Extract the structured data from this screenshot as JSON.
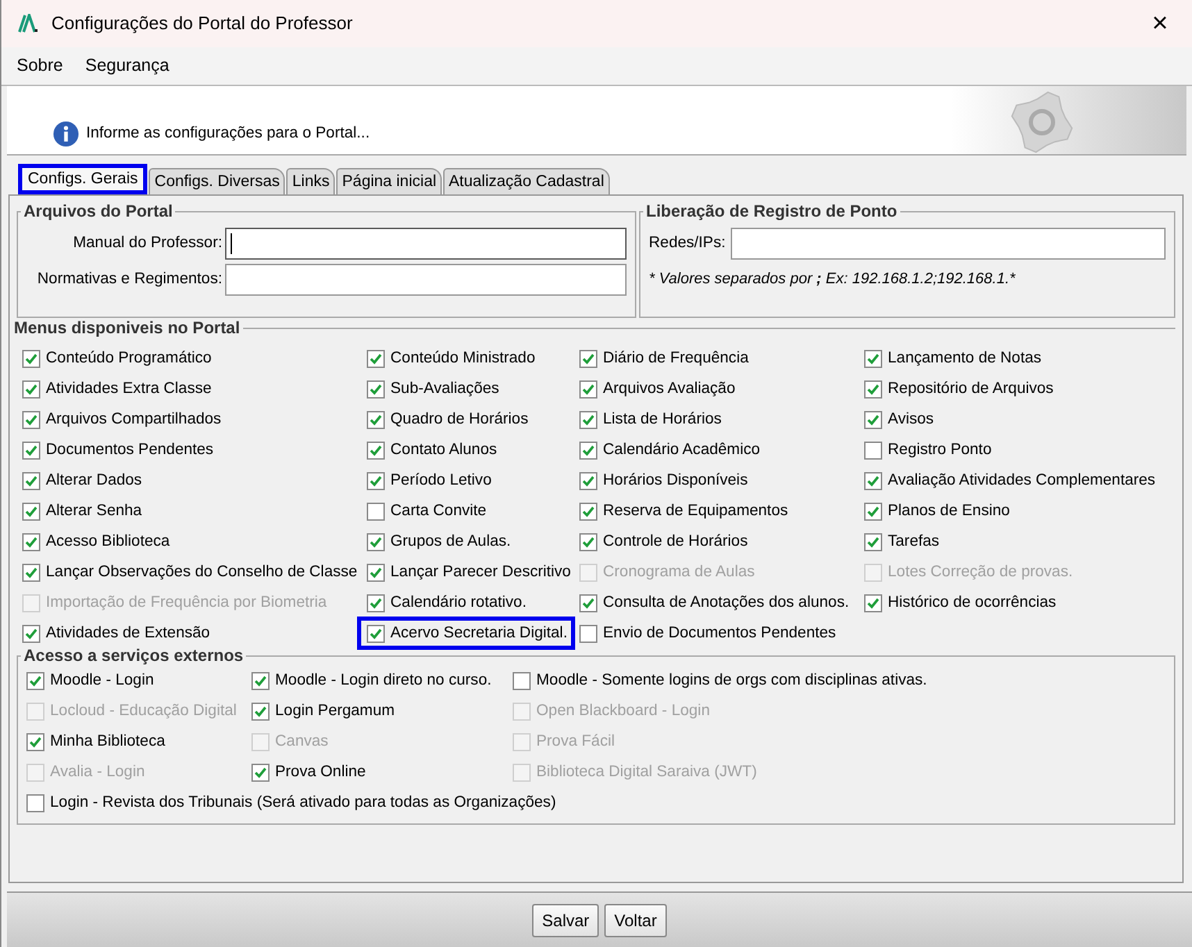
{
  "window": {
    "title": "Configurações do Portal do Professor",
    "close": "×"
  },
  "menu_bar": [
    "Sobre",
    "Segurança"
  ],
  "header": {
    "message": "Informe as configurações para o Portal..."
  },
  "tabs": [
    {
      "label": "Configs. Gerais",
      "selected": true,
      "highlighted": true
    },
    {
      "label": "Configs. Diversas",
      "selected": false,
      "highlighted": false
    },
    {
      "label": "Links",
      "selected": false,
      "highlighted": false
    },
    {
      "label": "Página inicial",
      "selected": false,
      "highlighted": false
    },
    {
      "label": "Atualização Cadastral",
      "selected": false,
      "highlighted": false
    }
  ],
  "arquivos": {
    "title": "Arquivos do Portal",
    "fields": [
      {
        "label": "Manual do Professor:",
        "focused": true
      },
      {
        "label": "Normativas e Regimentos:",
        "focused": false
      }
    ]
  },
  "ponto": {
    "title": "Liberação de Registro de Ponto",
    "field_label": "Redes/IPs:",
    "hint": "* Valores separados por **;** Ex: 192.168.1.2;192.168.1.*"
  },
  "menus": {
    "title": "Menus disponiveis no Portal",
    "items": [
      {
        "label": "Conteúdo Programático",
        "checked": true,
        "disabled": false,
        "highlighted": false
      },
      {
        "label": "Conteúdo Ministrado",
        "checked": true,
        "disabled": false,
        "highlighted": false
      },
      {
        "label": "Diário de Frequência",
        "checked": true,
        "disabled": false,
        "highlighted": false
      },
      {
        "label": "Lançamento de Notas",
        "checked": true,
        "disabled": false,
        "highlighted": false
      },
      {
        "label": "Atividades Extra Classe",
        "checked": true,
        "disabled": false,
        "highlighted": false
      },
      {
        "label": "Sub-Avaliações",
        "checked": true,
        "disabled": false,
        "highlighted": false
      },
      {
        "label": "Arquivos Avaliação",
        "checked": true,
        "disabled": false,
        "highlighted": false
      },
      {
        "label": "Repositório de Arquivos",
        "checked": true,
        "disabled": false,
        "highlighted": false
      },
      {
        "label": "Arquivos Compartilhados",
        "checked": true,
        "disabled": false,
        "highlighted": false
      },
      {
        "label": "Quadro de Horários",
        "checked": true,
        "disabled": false,
        "highlighted": false
      },
      {
        "label": "Lista de Horários",
        "checked": true,
        "disabled": false,
        "highlighted": false
      },
      {
        "label": "Avisos",
        "checked": true,
        "disabled": false,
        "highlighted": false
      },
      {
        "label": "Documentos Pendentes",
        "checked": true,
        "disabled": false,
        "highlighted": false
      },
      {
        "label": "Contato Alunos",
        "checked": true,
        "disabled": false,
        "highlighted": false
      },
      {
        "label": "Calendário Acadêmico",
        "checked": true,
        "disabled": false,
        "highlighted": false
      },
      {
        "label": "Registro Ponto",
        "checked": false,
        "disabled": false,
        "highlighted": false
      },
      {
        "label": "Alterar Dados",
        "checked": true,
        "disabled": false,
        "highlighted": false
      },
      {
        "label": "Período Letivo",
        "checked": true,
        "disabled": false,
        "highlighted": false
      },
      {
        "label": "Horários Disponíveis",
        "checked": true,
        "disabled": false,
        "highlighted": false
      },
      {
        "label": "Avaliação Atividades Complementares",
        "checked": true,
        "disabled": false,
        "highlighted": false
      },
      {
        "label": "Alterar Senha",
        "checked": true,
        "disabled": false,
        "highlighted": false
      },
      {
        "label": "Carta Convite",
        "checked": false,
        "disabled": false,
        "highlighted": false
      },
      {
        "label": "Reserva de Equipamentos",
        "checked": true,
        "disabled": false,
        "highlighted": false
      },
      {
        "label": "Planos de Ensino",
        "checked": true,
        "disabled": false,
        "highlighted": false
      },
      {
        "label": "Acesso Biblioteca",
        "checked": true,
        "disabled": false,
        "highlighted": false
      },
      {
        "label": "Grupos de Aulas.",
        "checked": true,
        "disabled": false,
        "highlighted": false
      },
      {
        "label": "Controle de Horários",
        "checked": true,
        "disabled": false,
        "highlighted": false
      },
      {
        "label": "Tarefas",
        "checked": true,
        "disabled": false,
        "highlighted": false
      },
      {
        "label": "Lançar Observações do Conselho de Classe",
        "checked": true,
        "disabled": false,
        "highlighted": false
      },
      {
        "label": "Lançar Parecer Descritivo",
        "checked": true,
        "disabled": false,
        "highlighted": false
      },
      {
        "label": "Cronograma de Aulas",
        "checked": false,
        "disabled": true,
        "highlighted": false
      },
      {
        "label": "Lotes Correção de provas.",
        "checked": false,
        "disabled": true,
        "highlighted": false
      },
      {
        "label": "Importação de Frequência por Biometria",
        "checked": false,
        "disabled": true,
        "highlighted": false
      },
      {
        "label": "Calendário rotativo.",
        "checked": true,
        "disabled": false,
        "highlighted": false
      },
      {
        "label": "Consulta de Anotações dos alunos.",
        "checked": true,
        "disabled": false,
        "highlighted": false
      },
      {
        "label": "Histórico de ocorrências",
        "checked": true,
        "disabled": false,
        "highlighted": false
      },
      {
        "label": "Atividades de Extensão",
        "checked": true,
        "disabled": false,
        "highlighted": false
      },
      {
        "label": "Acervo Secretaria Digital.",
        "checked": true,
        "disabled": false,
        "highlighted": true
      },
      {
        "label": "Envio de Documentos Pendentes",
        "checked": false,
        "disabled": false,
        "highlighted": false
      }
    ]
  },
  "externos": {
    "title": "Acesso a serviços externos",
    "items": [
      {
        "label": "Moodle - Login",
        "checked": true,
        "disabled": false
      },
      {
        "label": "Moodle - Login direto no curso.",
        "checked": true,
        "disabled": false
      },
      {
        "label": "Moodle - Somente logins de orgs com disciplinas ativas.",
        "checked": false,
        "disabled": false
      },
      {
        "label": "Locloud - Educação Digital",
        "checked": false,
        "disabled": true
      },
      {
        "label": "Login Pergamum",
        "checked": true,
        "disabled": false
      },
      {
        "label": "Open Blackboard - Login",
        "checked": false,
        "disabled": true
      },
      {
        "label": "Minha Biblioteca",
        "checked": true,
        "disabled": false
      },
      {
        "label": "Canvas",
        "checked": false,
        "disabled": true
      },
      {
        "label": "Prova Fácil",
        "checked": false,
        "disabled": true
      },
      {
        "label": "Avalia - Login",
        "checked": false,
        "disabled": true
      },
      {
        "label": "Prova Online",
        "checked": true,
        "disabled": false
      },
      {
        "label": "Biblioteca Digital Saraiva (JWT)",
        "checked": false,
        "disabled": true
      },
      {
        "label": "Login - Revista dos Tribunais (Será ativado para todas as Organizações)",
        "checked": false,
        "disabled": false
      }
    ]
  },
  "buttons": [
    "Salvar",
    "Voltar"
  ]
}
